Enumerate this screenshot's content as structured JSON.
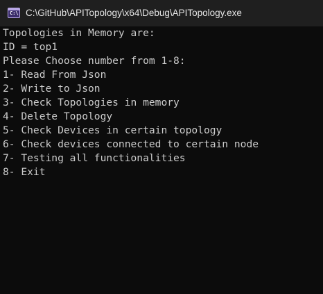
{
  "window": {
    "title": "C:\\GitHub\\APITopology\\x64\\Debug\\APITopology.exe",
    "icon": "console-app-icon",
    "icon_glyph": "C:\\"
  },
  "console": {
    "lines": [
      "Topologies in Memory are:",
      "ID = top1",
      "Please Choose number from 1-8:",
      "1- Read From Json",
      "2- Write to Json",
      "3- Check Topologies in memory",
      "4- Delete Topology",
      "5- Check Devices in certain topology",
      "6- Check devices connected to certain node",
      "7- Testing all functionalities",
      "8- Exit"
    ]
  },
  "colors": {
    "background": "#0c0c0c",
    "titlebar": "#1f1f1f",
    "text": "#cccccc",
    "title_text": "#e6e6e6",
    "icon_accent": "#b9a7e6"
  }
}
